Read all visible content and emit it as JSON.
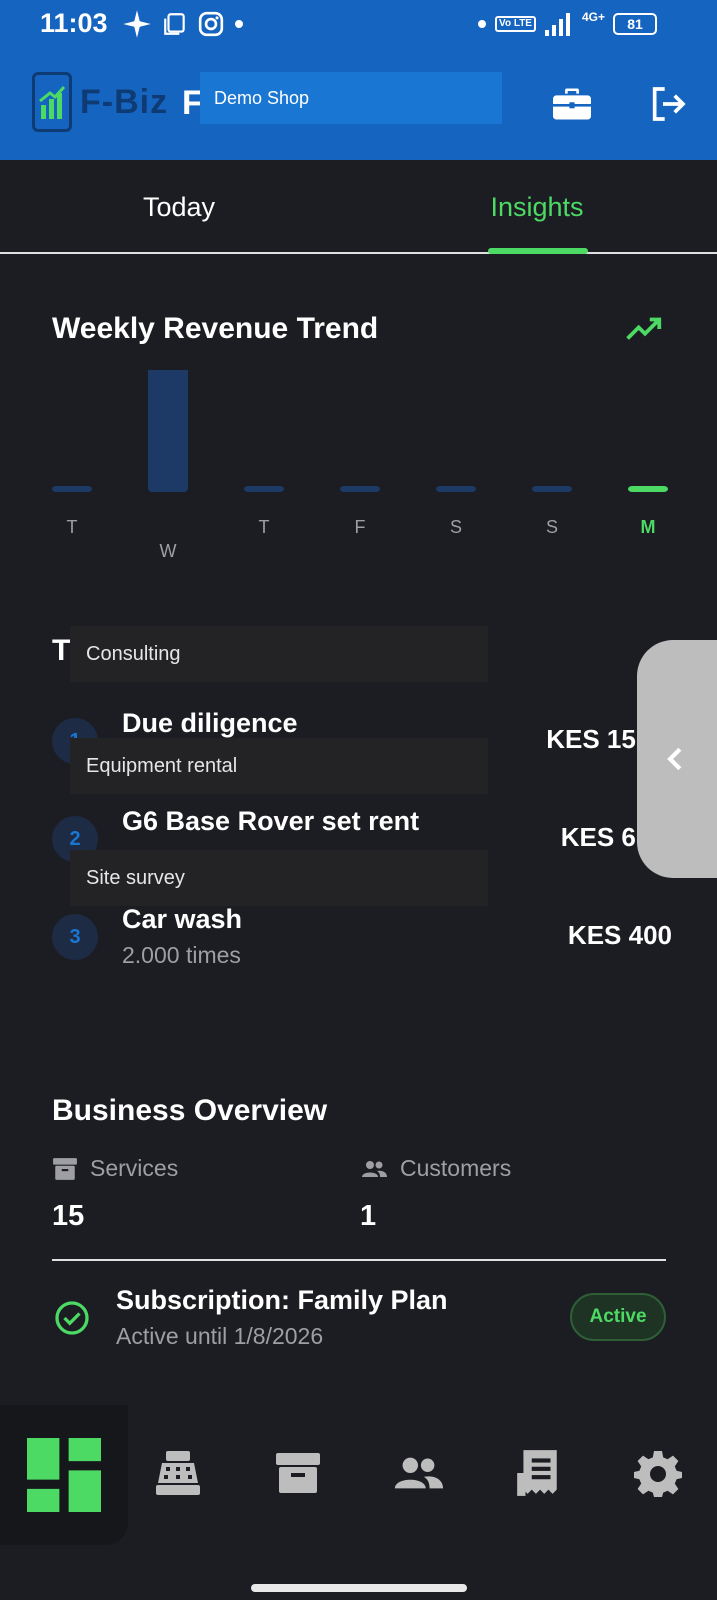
{
  "status_bar": {
    "time": "11:03",
    "battery": "81",
    "network": "4G+",
    "volte": "Vo LTE"
  },
  "app_bar": {
    "logo_text": "F-Biz",
    "title_initial": "F",
    "shop_name": "Demo Shop"
  },
  "tabs": [
    {
      "label": "Today"
    },
    {
      "label": "Insights"
    }
  ],
  "revenue": {
    "title": "Weekly Revenue Trend",
    "chart_data": {
      "type": "bar",
      "categories": [
        "T",
        "W",
        "T",
        "F",
        "S",
        "S",
        "M"
      ],
      "values": [
        0,
        15000,
        0,
        0,
        0,
        0,
        400
      ],
      "highlighted": "M",
      "title": "Weekly Revenue Trend",
      "xlabel": "",
      "ylabel": "",
      "grid": false
    }
  },
  "top_services": {
    "title_initial": "T",
    "items": [
      {
        "rank": "1",
        "name": "Due diligence",
        "amount": "KES 15,00"
      },
      {
        "rank": "2",
        "name": "G6 Base Rover set rent",
        "amount": "KES 6,00"
      },
      {
        "rank": "3",
        "name": "Car wash",
        "sub": "2.000 times",
        "amount": "KES 400"
      }
    ],
    "dropdown": [
      "Consulting",
      "Equipment rental",
      "Site survey"
    ]
  },
  "overview": {
    "title": "Business Overview",
    "services_label": "Services",
    "services_value": "15",
    "customers_label": "Customers",
    "customers_value": "1",
    "subscription_title": "Subscription: Family Plan",
    "subscription_sub": "Active until 1/8/2026",
    "status": "Active"
  },
  "colors": {
    "accent": "#4cd964",
    "brand": "#1565c0",
    "bar": "#1d3a66",
    "background": "#1c1d22"
  },
  "bottom_nav": {
    "items": [
      {
        "icon": "dashboard-icon"
      },
      {
        "icon": "cash-register-icon"
      },
      {
        "icon": "archive-icon"
      },
      {
        "icon": "people-icon"
      },
      {
        "icon": "receipt-icon"
      },
      {
        "icon": "gear-icon"
      }
    ]
  }
}
